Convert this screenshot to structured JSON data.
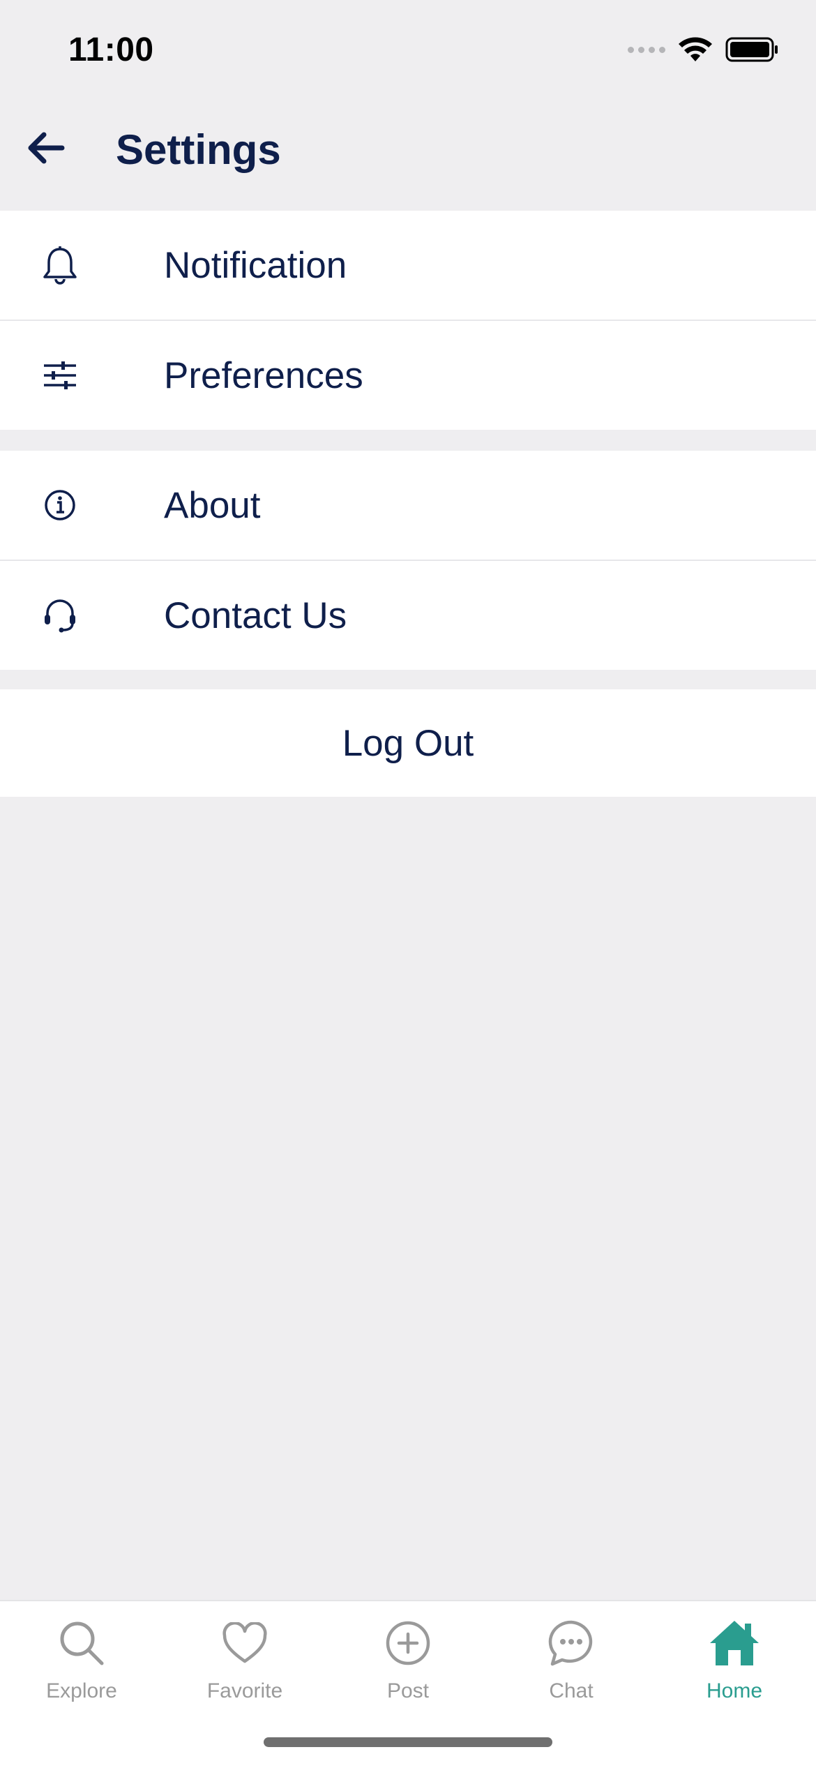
{
  "status_bar": {
    "time": "11:00"
  },
  "header": {
    "title": "Settings"
  },
  "groups": [
    {
      "items": [
        {
          "label": "Notification",
          "icon": "bell-icon"
        },
        {
          "label": "Preferences",
          "icon": "sliders-icon"
        }
      ]
    },
    {
      "items": [
        {
          "label": "About",
          "icon": "info-icon"
        },
        {
          "label": "Contact Us",
          "icon": "headset-icon"
        }
      ]
    }
  ],
  "logout": {
    "label": "Log Out"
  },
  "tabbar": {
    "tabs": [
      {
        "label": "Explore",
        "icon": "search-icon"
      },
      {
        "label": "Favorite",
        "icon": "heart-icon"
      },
      {
        "label": "Post",
        "icon": "plus-circle-icon"
      },
      {
        "label": "Chat",
        "icon": "chat-bubble-icon"
      },
      {
        "label": "Home",
        "icon": "home-icon"
      }
    ],
    "active": "Home"
  },
  "colors": {
    "primary_text": "#0f1f4b",
    "accent": "#2a9d8f",
    "background": "#efeef0",
    "inactive_tab": "#9a9a9a"
  }
}
